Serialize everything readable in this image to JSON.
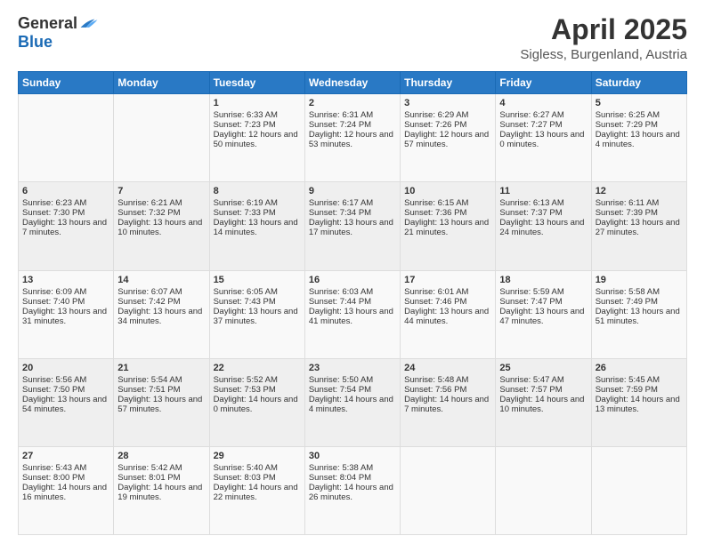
{
  "header": {
    "logo_general": "General",
    "logo_blue": "Blue",
    "month_title": "April 2025",
    "location": "Sigless, Burgenland, Austria"
  },
  "days_of_week": [
    "Sunday",
    "Monday",
    "Tuesday",
    "Wednesday",
    "Thursday",
    "Friday",
    "Saturday"
  ],
  "weeks": [
    [
      {
        "day": "",
        "sunrise": "",
        "sunset": "",
        "daylight": ""
      },
      {
        "day": "",
        "sunrise": "",
        "sunset": "",
        "daylight": ""
      },
      {
        "day": "1",
        "sunrise": "Sunrise: 6:33 AM",
        "sunset": "Sunset: 7:23 PM",
        "daylight": "Daylight: 12 hours and 50 minutes."
      },
      {
        "day": "2",
        "sunrise": "Sunrise: 6:31 AM",
        "sunset": "Sunset: 7:24 PM",
        "daylight": "Daylight: 12 hours and 53 minutes."
      },
      {
        "day": "3",
        "sunrise": "Sunrise: 6:29 AM",
        "sunset": "Sunset: 7:26 PM",
        "daylight": "Daylight: 12 hours and 57 minutes."
      },
      {
        "day": "4",
        "sunrise": "Sunrise: 6:27 AM",
        "sunset": "Sunset: 7:27 PM",
        "daylight": "Daylight: 13 hours and 0 minutes."
      },
      {
        "day": "5",
        "sunrise": "Sunrise: 6:25 AM",
        "sunset": "Sunset: 7:29 PM",
        "daylight": "Daylight: 13 hours and 4 minutes."
      }
    ],
    [
      {
        "day": "6",
        "sunrise": "Sunrise: 6:23 AM",
        "sunset": "Sunset: 7:30 PM",
        "daylight": "Daylight: 13 hours and 7 minutes."
      },
      {
        "day": "7",
        "sunrise": "Sunrise: 6:21 AM",
        "sunset": "Sunset: 7:32 PM",
        "daylight": "Daylight: 13 hours and 10 minutes."
      },
      {
        "day": "8",
        "sunrise": "Sunrise: 6:19 AM",
        "sunset": "Sunset: 7:33 PM",
        "daylight": "Daylight: 13 hours and 14 minutes."
      },
      {
        "day": "9",
        "sunrise": "Sunrise: 6:17 AM",
        "sunset": "Sunset: 7:34 PM",
        "daylight": "Daylight: 13 hours and 17 minutes."
      },
      {
        "day": "10",
        "sunrise": "Sunrise: 6:15 AM",
        "sunset": "Sunset: 7:36 PM",
        "daylight": "Daylight: 13 hours and 21 minutes."
      },
      {
        "day": "11",
        "sunrise": "Sunrise: 6:13 AM",
        "sunset": "Sunset: 7:37 PM",
        "daylight": "Daylight: 13 hours and 24 minutes."
      },
      {
        "day": "12",
        "sunrise": "Sunrise: 6:11 AM",
        "sunset": "Sunset: 7:39 PM",
        "daylight": "Daylight: 13 hours and 27 minutes."
      }
    ],
    [
      {
        "day": "13",
        "sunrise": "Sunrise: 6:09 AM",
        "sunset": "Sunset: 7:40 PM",
        "daylight": "Daylight: 13 hours and 31 minutes."
      },
      {
        "day": "14",
        "sunrise": "Sunrise: 6:07 AM",
        "sunset": "Sunset: 7:42 PM",
        "daylight": "Daylight: 13 hours and 34 minutes."
      },
      {
        "day": "15",
        "sunrise": "Sunrise: 6:05 AM",
        "sunset": "Sunset: 7:43 PM",
        "daylight": "Daylight: 13 hours and 37 minutes."
      },
      {
        "day": "16",
        "sunrise": "Sunrise: 6:03 AM",
        "sunset": "Sunset: 7:44 PM",
        "daylight": "Daylight: 13 hours and 41 minutes."
      },
      {
        "day": "17",
        "sunrise": "Sunrise: 6:01 AM",
        "sunset": "Sunset: 7:46 PM",
        "daylight": "Daylight: 13 hours and 44 minutes."
      },
      {
        "day": "18",
        "sunrise": "Sunrise: 5:59 AM",
        "sunset": "Sunset: 7:47 PM",
        "daylight": "Daylight: 13 hours and 47 minutes."
      },
      {
        "day": "19",
        "sunrise": "Sunrise: 5:58 AM",
        "sunset": "Sunset: 7:49 PM",
        "daylight": "Daylight: 13 hours and 51 minutes."
      }
    ],
    [
      {
        "day": "20",
        "sunrise": "Sunrise: 5:56 AM",
        "sunset": "Sunset: 7:50 PM",
        "daylight": "Daylight: 13 hours and 54 minutes."
      },
      {
        "day": "21",
        "sunrise": "Sunrise: 5:54 AM",
        "sunset": "Sunset: 7:51 PM",
        "daylight": "Daylight: 13 hours and 57 minutes."
      },
      {
        "day": "22",
        "sunrise": "Sunrise: 5:52 AM",
        "sunset": "Sunset: 7:53 PM",
        "daylight": "Daylight: 14 hours and 0 minutes."
      },
      {
        "day": "23",
        "sunrise": "Sunrise: 5:50 AM",
        "sunset": "Sunset: 7:54 PM",
        "daylight": "Daylight: 14 hours and 4 minutes."
      },
      {
        "day": "24",
        "sunrise": "Sunrise: 5:48 AM",
        "sunset": "Sunset: 7:56 PM",
        "daylight": "Daylight: 14 hours and 7 minutes."
      },
      {
        "day": "25",
        "sunrise": "Sunrise: 5:47 AM",
        "sunset": "Sunset: 7:57 PM",
        "daylight": "Daylight: 14 hours and 10 minutes."
      },
      {
        "day": "26",
        "sunrise": "Sunrise: 5:45 AM",
        "sunset": "Sunset: 7:59 PM",
        "daylight": "Daylight: 14 hours and 13 minutes."
      }
    ],
    [
      {
        "day": "27",
        "sunrise": "Sunrise: 5:43 AM",
        "sunset": "Sunset: 8:00 PM",
        "daylight": "Daylight: 14 hours and 16 minutes."
      },
      {
        "day": "28",
        "sunrise": "Sunrise: 5:42 AM",
        "sunset": "Sunset: 8:01 PM",
        "daylight": "Daylight: 14 hours and 19 minutes."
      },
      {
        "day": "29",
        "sunrise": "Sunrise: 5:40 AM",
        "sunset": "Sunset: 8:03 PM",
        "daylight": "Daylight: 14 hours and 22 minutes."
      },
      {
        "day": "30",
        "sunrise": "Sunrise: 5:38 AM",
        "sunset": "Sunset: 8:04 PM",
        "daylight": "Daylight: 14 hours and 26 minutes."
      },
      {
        "day": "",
        "sunrise": "",
        "sunset": "",
        "daylight": ""
      },
      {
        "day": "",
        "sunrise": "",
        "sunset": "",
        "daylight": ""
      },
      {
        "day": "",
        "sunrise": "",
        "sunset": "",
        "daylight": ""
      }
    ]
  ]
}
